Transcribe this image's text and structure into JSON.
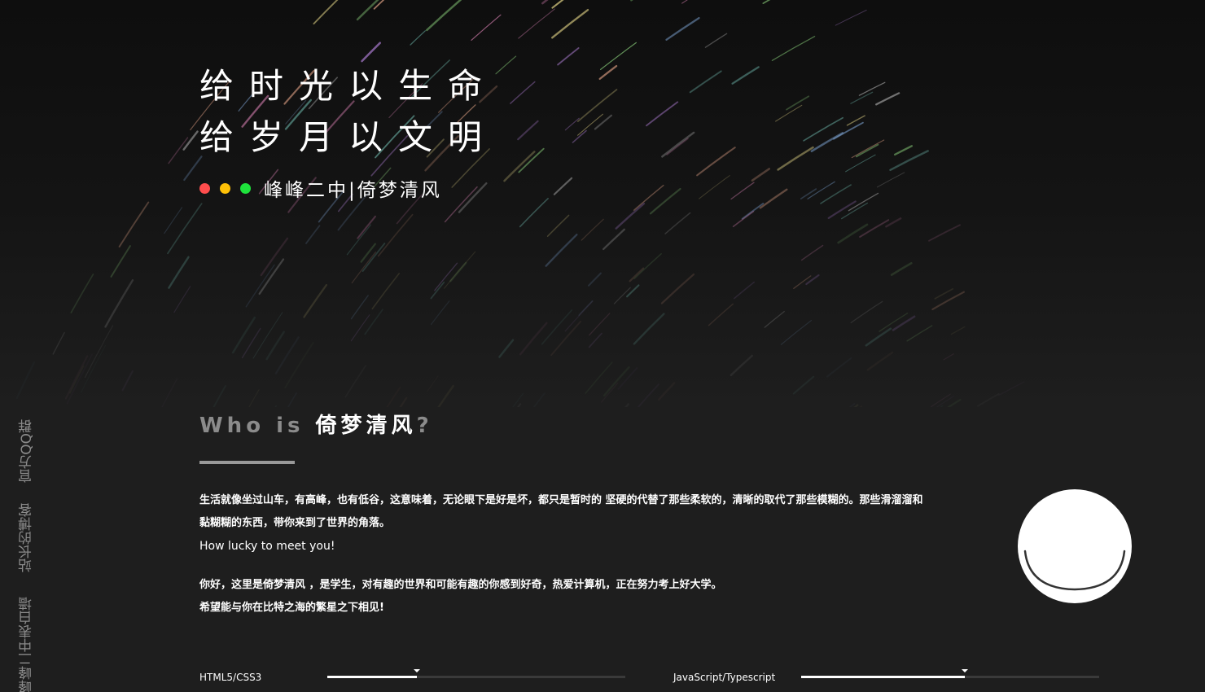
{
  "hero": {
    "title_line1": "给时光以生命",
    "title_line2": "给岁月以文明",
    "subtitle": "峰峰二中|倚梦清风",
    "dots": [
      {
        "name": "red-dot",
        "color": "#ff4d4d"
      },
      {
        "name": "yellow-dot",
        "color": "#ffc107"
      },
      {
        "name": "green-dot",
        "color": "#1ee33c"
      }
    ]
  },
  "sidebar": {
    "links": [
      {
        "label": "官方QQ群"
      },
      {
        "label": "站长的博客"
      },
      {
        "label": "峰峰二中表白墙"
      }
    ]
  },
  "about": {
    "heading_prefix": "Who is ",
    "heading_name": "倚梦清风",
    "heading_suffix": "?",
    "para1_line1": "生活就像坐过山车，有高峰，也有低谷，这意味着，无论眼下是好是坏，都只是暂时的 坚硬的代替了那些柔软的，清晰的取代了那些模糊的。那些滑溜溜和",
    "para1_line2": "黏糊糊的东西，带你来到了世界的角落。",
    "lucky": "How lucky to meet you!",
    "para2_line1": "你好，这里是倚梦清风 ，是学生，对有趣的世界和可能有趣的你感到好奇，热爱计算机，正在努力考上好大学。",
    "para2_line2": "希望能与你在比特之海的繁星之下相见!"
  },
  "skills": [
    {
      "label": "HTML5/CSS3",
      "level": 0.3
    },
    {
      "label": "JavaScript/Typescript",
      "level": 0.55
    }
  ],
  "colors": {
    "background": "#1e1e1e",
    "heading_grey": "#8b8b8b",
    "side_link": "#8a8a8a"
  }
}
